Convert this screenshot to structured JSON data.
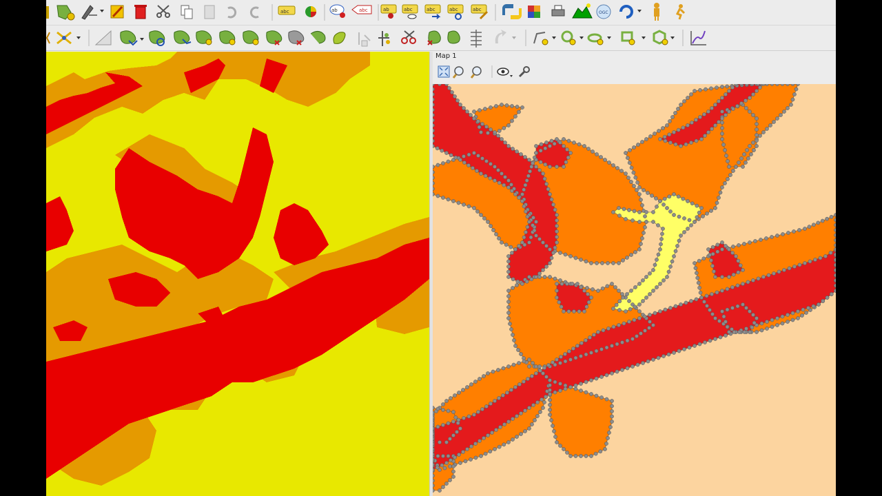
{
  "toolbars": {
    "top": [
      "edit-toolbox-icon",
      "digitize-icon",
      "pencil-edit-icon",
      "delete-icon",
      "cut-icon",
      "copy-icon",
      "paste-icon",
      "undo-icon",
      "redo-icon",
      "label-abc-icon",
      "diagram-icon",
      "label-pin-icon",
      "label-remove-icon",
      "label-move-icon",
      "label-show-hide-icon",
      "label-rotate-icon",
      "label-reset-icon",
      "label-change-icon",
      "python-icon",
      "plugin-icon",
      "print-icon",
      "terrain-icon",
      "ogc-icon",
      "refresh-icon",
      "user-icon",
      "run-icon"
    ],
    "second": [
      "node-tool-icon",
      "snap-icon",
      "measure-icon",
      "reshape-icon",
      "rotate-feature-icon",
      "simplify-icon",
      "add-ring-icon",
      "add-part-icon",
      "delete-ring-icon",
      "delete-part-icon",
      "reshape-feature-icon",
      "offset-curve-icon",
      "split-feature-icon",
      "split-parts-icon",
      "merge-icon",
      "merge-attributes-icon",
      "rotate-point-icon",
      "add-circle-icon",
      "add-ellipse-icon",
      "add-rectangle-icon",
      "add-polygon-icon",
      "profile-icon"
    ]
  },
  "map_panel": {
    "title": "Map 1",
    "tools": [
      "zoom-full-icon",
      "zoom-layer-icon",
      "zoom-selection-icon",
      "view-theme-icon",
      "settings-wrench-icon"
    ]
  },
  "colors": {
    "raster_high": "#e80000",
    "raster_mid": "#e59a00",
    "raster_low": "#e8e800",
    "vector_high": "#e41a1c",
    "vector_mid": "#ff7f00",
    "vector_low": "#fcd49f",
    "vector_highlight": "#ffff66",
    "vertex_marker": "#8c8c8c"
  }
}
